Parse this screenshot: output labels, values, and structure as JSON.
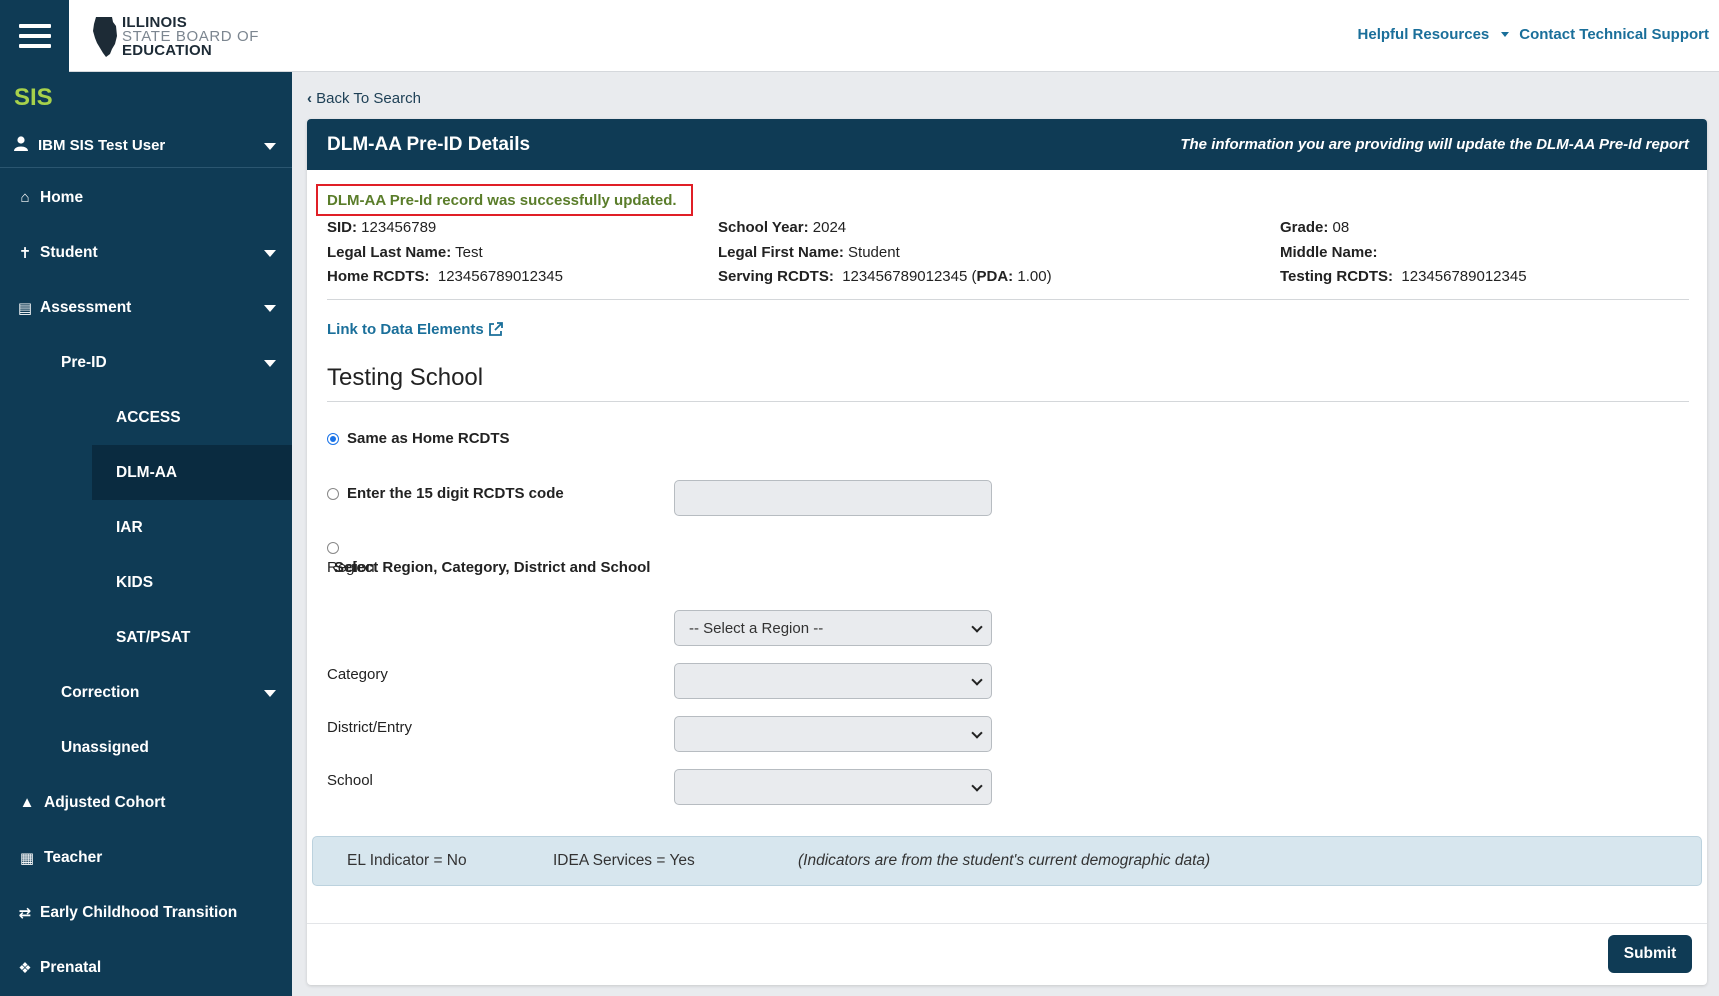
{
  "header": {
    "logo": {
      "line1": "ILLINOIS",
      "line2": "STATE BOARD OF",
      "line3": "EDUCATION"
    },
    "helpful_resources": "Helpful Resources",
    "contact_support": "Contact Technical Support"
  },
  "sidebar": {
    "app_name": "SIS",
    "user": "IBM SIS Test User",
    "home": "Home",
    "student": "Student",
    "assessment": "Assessment",
    "pre_id": "Pre-ID",
    "access": "ACCESS",
    "dlm_aa": "DLM-AA",
    "iar": "IAR",
    "kids": "KIDS",
    "sat_psat": "SAT/PSAT",
    "correction": "Correction",
    "unassigned": "Unassigned",
    "adjusted_cohort": "Adjusted Cohort",
    "teacher": "Teacher",
    "early_childhood": "Early Childhood Transition",
    "prenatal": "Prenatal"
  },
  "main": {
    "back": "Back To Search",
    "card_title": "DLM-AA Pre-ID Details",
    "card_note": "The information you are providing will update the DLM-AA Pre-Id report",
    "success": "DLM-AA Pre-Id record was successfully updated.",
    "student": {
      "sid_label": "SID:",
      "sid": "123456789",
      "school_year_label": "School Year:",
      "school_year": "2024",
      "grade_label": "Grade:",
      "grade": "08",
      "last_name_label": "Legal Last Name:",
      "last_name": "Test",
      "first_name_label": "Legal First Name:",
      "first_name": "Student",
      "middle_name_label": "Middle Name:",
      "middle_name": "",
      "home_rcdts_label": "Home RCDTS:",
      "home_rcdts": "123456789012345",
      "serving_rcdts_label": "Serving RCDTS:",
      "serving_rcdts": "123456789012345",
      "pda_open": "(",
      "pda_label": "PDA:",
      "pda": "1.00",
      "pda_close": ")",
      "testing_rcdts_label": "Testing RCDTS:",
      "testing_rcdts": "123456789012345"
    },
    "link_data_elements": "Link to Data Elements",
    "testing_school_title": "Testing School",
    "radio_same": "Same as Home RCDTS",
    "radio_enter": "Enter the 15 digit RCDTS code",
    "radio_select": "Select Region, Category, District and School",
    "rcdts_value": "",
    "region_label": "Region",
    "region_value": "-- Select a Region --",
    "category_label": "Category",
    "category_value": "",
    "district_label": "District/Entry",
    "district_value": "",
    "school_label": "School",
    "school_value": "",
    "el_indicator": "EL Indicator = No",
    "idea_services": "IDEA Services = Yes",
    "indicators_note": "(Indicators are from the student's current demographic data)",
    "submit": "Submit"
  }
}
